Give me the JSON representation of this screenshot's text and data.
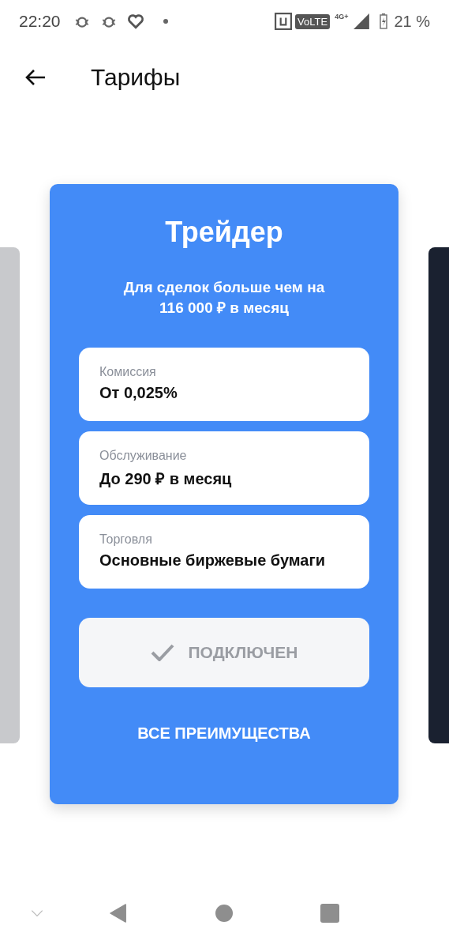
{
  "status_bar": {
    "time": "22:20",
    "network_badge": "VoLTE",
    "network_type": "4G+",
    "battery": "21 %"
  },
  "header": {
    "title": "Тарифы"
  },
  "tariff": {
    "title": "Трейдер",
    "subtitle": "Для сделок больше чем на 116 000 ₽ в месяц",
    "features": [
      {
        "label": "Комиссия",
        "value": "От 0,025%"
      },
      {
        "label": "Обслуживание",
        "value": "До 290 ₽ в месяц"
      },
      {
        "label": "Торговля",
        "value": "Основные биржевые бумаги"
      }
    ],
    "action": {
      "label": "ПОДКЛЮЧЕН",
      "disabled": true
    },
    "link": "ВСЕ ПРЕИМУЩЕСТВА"
  }
}
